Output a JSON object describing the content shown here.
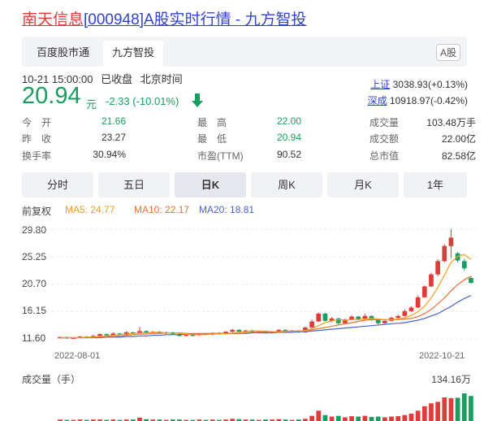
{
  "header": {
    "title_name": "南天信息",
    "title_code": "[000948]",
    "title_rest": "A股实时行情 - 九方智投"
  },
  "tabs": [
    {
      "label": "百度股市通"
    },
    {
      "label": "九方智投"
    }
  ],
  "market_badge": "A股",
  "status": {
    "datetime": "10-21 15:00:00",
    "state": "已收盘",
    "tz": "北京时间"
  },
  "quote": {
    "price": "20.94",
    "unit": "元",
    "change": "-2.33 (-10.01%)",
    "color_down": "#1a9e60",
    "color_up": "#e03b3b"
  },
  "indices": [
    {
      "name": "上证",
      "value": "3038.93(+0.13%)"
    },
    {
      "name": "深成",
      "value": "10918.97(-0.42%)"
    }
  ],
  "stats": {
    "open_label": "今　开",
    "open": "21.66",
    "prev_label": "昨　收",
    "prev": "23.27",
    "turnover_label": "换手率",
    "turnover": "30.94%",
    "high_label": "最　高",
    "high": "22.00",
    "low_label": "最　低",
    "low": "20.94",
    "pe_label": "市盈(TTM)",
    "pe": "90.52",
    "vol_label": "成交量",
    "vol": "103.48万手",
    "amount_label": "成交额",
    "amount": "22.00亿",
    "mcap_label": "总市值",
    "mcap": "82.58亿"
  },
  "period_tabs": [
    {
      "label": "分时"
    },
    {
      "label": "五日"
    },
    {
      "label": "日K"
    },
    {
      "label": "周K"
    },
    {
      "label": "月K"
    },
    {
      "label": "1年"
    }
  ],
  "active_period": "日K",
  "indicators": {
    "adjust": "前复权",
    "ma5": "MA5: 24.77",
    "ma10": "MA10: 22.17",
    "ma20": "MA20: 18.81",
    "ma5_color": "#f0a020",
    "ma10_color": "#e8703a",
    "ma20_color": "#4a63c8"
  },
  "chart_data": {
    "type": "candlestick",
    "y_ticks": [
      "29.80",
      "25.25",
      "20.70",
      "16.15",
      "11.60"
    ],
    "ylim": [
      11.6,
      29.8
    ],
    "x_labels": [
      "2022-08-01",
      "2022-10-21"
    ],
    "candles": [
      [
        11.8,
        11.9,
        12.0,
        11.7
      ],
      [
        11.9,
        11.7,
        12.0,
        11.6
      ],
      [
        11.7,
        11.8,
        11.9,
        11.6
      ],
      [
        11.8,
        12.0,
        12.1,
        11.7
      ],
      [
        12.0,
        11.9,
        12.1,
        11.8
      ],
      [
        11.9,
        12.1,
        12.3,
        11.8
      ],
      [
        12.1,
        12.4,
        12.5,
        12.0
      ],
      [
        12.4,
        12.2,
        12.5,
        12.1
      ],
      [
        12.2,
        12.5,
        12.7,
        12.1
      ],
      [
        12.5,
        12.3,
        12.6,
        12.2
      ],
      [
        12.3,
        12.7,
        12.9,
        12.2
      ],
      [
        12.7,
        12.6,
        12.8,
        12.4
      ],
      [
        12.6,
        12.9,
        13.6,
        12.5
      ],
      [
        12.9,
        12.6,
        13.0,
        12.5
      ],
      [
        12.6,
        12.8,
        12.9,
        12.5
      ],
      [
        12.8,
        12.5,
        12.9,
        12.4
      ],
      [
        12.5,
        12.7,
        12.8,
        12.4
      ],
      [
        12.7,
        12.4,
        12.8,
        12.3
      ],
      [
        12.4,
        12.1,
        12.5,
        12.0
      ],
      [
        12.1,
        12.3,
        12.4,
        12.0
      ],
      [
        12.3,
        12.2,
        12.4,
        12.0
      ],
      [
        12.2,
        12.5,
        12.6,
        12.1
      ],
      [
        12.5,
        12.3,
        12.6,
        12.2
      ],
      [
        12.3,
        12.6,
        12.7,
        12.2
      ],
      [
        12.6,
        12.4,
        12.7,
        12.3
      ],
      [
        12.4,
        12.8,
        12.9,
        12.3
      ],
      [
        12.8,
        13.1,
        13.3,
        12.7
      ],
      [
        13.1,
        12.8,
        13.2,
        12.7
      ],
      [
        12.8,
        13.0,
        13.1,
        12.7
      ],
      [
        13.0,
        12.7,
        13.1,
        12.6
      ],
      [
        12.7,
        12.9,
        13.0,
        12.6
      ],
      [
        12.9,
        12.6,
        13.0,
        12.5
      ],
      [
        12.6,
        12.8,
        12.9,
        12.5
      ],
      [
        12.8,
        13.1,
        13.2,
        12.7
      ],
      [
        13.1,
        12.9,
        13.2,
        12.8
      ],
      [
        12.9,
        13.0,
        13.1,
        12.8
      ],
      [
        13.0,
        12.7,
        13.1,
        12.6
      ],
      [
        12.7,
        13.5,
        13.7,
        12.6
      ],
      [
        13.5,
        14.5,
        14.8,
        13.4
      ],
      [
        14.5,
        15.8,
        16.0,
        14.4
      ],
      [
        15.8,
        14.6,
        15.9,
        14.5
      ],
      [
        14.6,
        15.0,
        15.2,
        14.4
      ],
      [
        15.0,
        14.2,
        15.1,
        14.0
      ],
      [
        14.2,
        14.8,
        15.0,
        14.1
      ],
      [
        14.8,
        15.3,
        15.5,
        14.7
      ],
      [
        15.3,
        14.9,
        15.4,
        14.7
      ],
      [
        14.9,
        15.4,
        15.8,
        14.8
      ],
      [
        15.4,
        14.8,
        15.5,
        14.6
      ],
      [
        14.8,
        14.2,
        14.9,
        14.0
      ],
      [
        14.2,
        14.6,
        14.8,
        14.1
      ],
      [
        14.6,
        15.1,
        15.3,
        14.5
      ],
      [
        15.1,
        15.4,
        15.6,
        15.0
      ],
      [
        15.4,
        16.2,
        16.5,
        15.3
      ],
      [
        16.2,
        16.8,
        17.0,
        16.1
      ],
      [
        16.8,
        18.5,
        18.8,
        16.7
      ],
      [
        18.5,
        20.3,
        20.5,
        18.4
      ],
      [
        20.3,
        22.3,
        22.6,
        20.2
      ],
      [
        22.3,
        24.5,
        24.8,
        22.0
      ],
      [
        24.5,
        27.0,
        27.3,
        24.3
      ],
      [
        27.0,
        28.4,
        29.8,
        25.0
      ],
      [
        25.8,
        24.6,
        26.0,
        24.3
      ],
      [
        24.5,
        23.3,
        24.9,
        22.9
      ],
      [
        21.7,
        20.9,
        22.0,
        20.8
      ]
    ],
    "ma5": [
      11.8,
      11.8,
      11.8,
      11.8,
      11.9,
      11.9,
      12.0,
      12.1,
      12.2,
      12.3,
      12.4,
      12.5,
      12.6,
      12.6,
      12.7,
      12.7,
      12.6,
      12.6,
      12.5,
      12.4,
      12.3,
      12.3,
      12.3,
      12.4,
      12.4,
      12.5,
      12.6,
      12.7,
      12.8,
      12.9,
      12.9,
      12.9,
      12.8,
      12.8,
      12.9,
      12.9,
      12.9,
      13.0,
      13.3,
      13.8,
      14.3,
      14.6,
      14.8,
      14.7,
      14.8,
      14.8,
      14.9,
      15.0,
      14.9,
      14.8,
      14.8,
      14.9,
      15.1,
      15.5,
      16.1,
      17.0,
      18.4,
      20.1,
      22.2,
      24.3,
      25.3,
      25.6,
      24.8
    ],
    "ma10": [
      11.8,
      11.8,
      11.8,
      11.8,
      11.8,
      11.9,
      11.9,
      12.0,
      12.0,
      12.1,
      12.2,
      12.3,
      12.4,
      12.4,
      12.5,
      12.5,
      12.6,
      12.6,
      12.6,
      12.5,
      12.5,
      12.5,
      12.5,
      12.5,
      12.5,
      12.5,
      12.5,
      12.5,
      12.6,
      12.7,
      12.7,
      12.8,
      12.8,
      12.8,
      12.8,
      12.9,
      12.9,
      12.9,
      13.1,
      13.3,
      13.5,
      13.7,
      13.9,
      14.1,
      14.3,
      14.5,
      14.7,
      14.8,
      14.8,
      14.8,
      14.8,
      14.8,
      14.9,
      15.0,
      15.3,
      15.8,
      16.5,
      17.4,
      18.4,
      19.6,
      20.6,
      21.4,
      22.0
    ],
    "ma20": [
      11.8,
      11.8,
      11.8,
      11.8,
      11.8,
      11.8,
      11.8,
      11.9,
      11.9,
      11.9,
      12.0,
      12.0,
      12.1,
      12.1,
      12.2,
      12.2,
      12.3,
      12.3,
      12.3,
      12.4,
      12.4,
      12.4,
      12.4,
      12.5,
      12.5,
      12.5,
      12.5,
      12.5,
      12.5,
      12.6,
      12.6,
      12.6,
      12.6,
      12.7,
      12.7,
      12.7,
      12.8,
      12.8,
      12.9,
      13.0,
      13.1,
      13.2,
      13.3,
      13.4,
      13.5,
      13.6,
      13.7,
      13.8,
      13.9,
      14.0,
      14.1,
      14.2,
      14.3,
      14.5,
      14.7,
      15.0,
      15.4,
      15.8,
      16.4,
      17.0,
      17.7,
      18.3,
      18.8
    ],
    "volumes": [
      4,
      3,
      3,
      4,
      3,
      4,
      4,
      3,
      4,
      3,
      4,
      4,
      9,
      5,
      4,
      4,
      3,
      4,
      4,
      3,
      3,
      4,
      3,
      4,
      3,
      4,
      6,
      5,
      4,
      4,
      3,
      4,
      4,
      5,
      4,
      3,
      4,
      6,
      14,
      28,
      16,
      12,
      14,
      10,
      13,
      12,
      14,
      11,
      12,
      10,
      12,
      13,
      16,
      20,
      28,
      40,
      48,
      52,
      64,
      62,
      63,
      75,
      68
    ],
    "vol_label": "成交量（手）",
    "vol_max_label": "134.16万"
  }
}
